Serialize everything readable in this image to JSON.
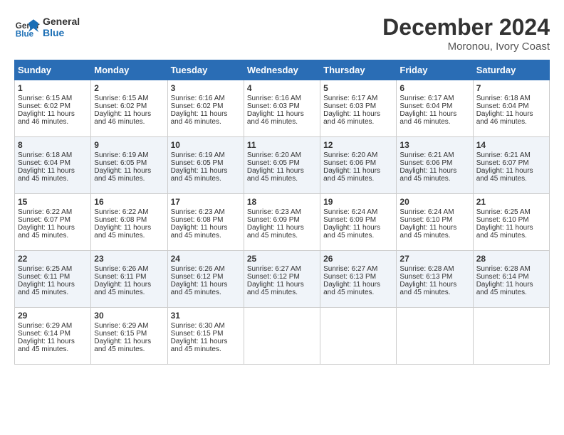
{
  "header": {
    "logo_line1": "General",
    "logo_line2": "Blue",
    "month_title": "December 2024",
    "location": "Moronou, Ivory Coast"
  },
  "days_of_week": [
    "Sunday",
    "Monday",
    "Tuesday",
    "Wednesday",
    "Thursday",
    "Friday",
    "Saturday"
  ],
  "weeks": [
    [
      {
        "day": "1",
        "sunrise": "Sunrise: 6:15 AM",
        "sunset": "Sunset: 6:02 PM",
        "daylight": "Daylight: 11 hours and 46 minutes."
      },
      {
        "day": "2",
        "sunrise": "Sunrise: 6:15 AM",
        "sunset": "Sunset: 6:02 PM",
        "daylight": "Daylight: 11 hours and 46 minutes."
      },
      {
        "day": "3",
        "sunrise": "Sunrise: 6:16 AM",
        "sunset": "Sunset: 6:02 PM",
        "daylight": "Daylight: 11 hours and 46 minutes."
      },
      {
        "day": "4",
        "sunrise": "Sunrise: 6:16 AM",
        "sunset": "Sunset: 6:03 PM",
        "daylight": "Daylight: 11 hours and 46 minutes."
      },
      {
        "day": "5",
        "sunrise": "Sunrise: 6:17 AM",
        "sunset": "Sunset: 6:03 PM",
        "daylight": "Daylight: 11 hours and 46 minutes."
      },
      {
        "day": "6",
        "sunrise": "Sunrise: 6:17 AM",
        "sunset": "Sunset: 6:04 PM",
        "daylight": "Daylight: 11 hours and 46 minutes."
      },
      {
        "day": "7",
        "sunrise": "Sunrise: 6:18 AM",
        "sunset": "Sunset: 6:04 PM",
        "daylight": "Daylight: 11 hours and 46 minutes."
      }
    ],
    [
      {
        "day": "8",
        "sunrise": "Sunrise: 6:18 AM",
        "sunset": "Sunset: 6:04 PM",
        "daylight": "Daylight: 11 hours and 45 minutes."
      },
      {
        "day": "9",
        "sunrise": "Sunrise: 6:19 AM",
        "sunset": "Sunset: 6:05 PM",
        "daylight": "Daylight: 11 hours and 45 minutes."
      },
      {
        "day": "10",
        "sunrise": "Sunrise: 6:19 AM",
        "sunset": "Sunset: 6:05 PM",
        "daylight": "Daylight: 11 hours and 45 minutes."
      },
      {
        "day": "11",
        "sunrise": "Sunrise: 6:20 AM",
        "sunset": "Sunset: 6:05 PM",
        "daylight": "Daylight: 11 hours and 45 minutes."
      },
      {
        "day": "12",
        "sunrise": "Sunrise: 6:20 AM",
        "sunset": "Sunset: 6:06 PM",
        "daylight": "Daylight: 11 hours and 45 minutes."
      },
      {
        "day": "13",
        "sunrise": "Sunrise: 6:21 AM",
        "sunset": "Sunset: 6:06 PM",
        "daylight": "Daylight: 11 hours and 45 minutes."
      },
      {
        "day": "14",
        "sunrise": "Sunrise: 6:21 AM",
        "sunset": "Sunset: 6:07 PM",
        "daylight": "Daylight: 11 hours and 45 minutes."
      }
    ],
    [
      {
        "day": "15",
        "sunrise": "Sunrise: 6:22 AM",
        "sunset": "Sunset: 6:07 PM",
        "daylight": "Daylight: 11 hours and 45 minutes."
      },
      {
        "day": "16",
        "sunrise": "Sunrise: 6:22 AM",
        "sunset": "Sunset: 6:08 PM",
        "daylight": "Daylight: 11 hours and 45 minutes."
      },
      {
        "day": "17",
        "sunrise": "Sunrise: 6:23 AM",
        "sunset": "Sunset: 6:08 PM",
        "daylight": "Daylight: 11 hours and 45 minutes."
      },
      {
        "day": "18",
        "sunrise": "Sunrise: 6:23 AM",
        "sunset": "Sunset: 6:09 PM",
        "daylight": "Daylight: 11 hours and 45 minutes."
      },
      {
        "day": "19",
        "sunrise": "Sunrise: 6:24 AM",
        "sunset": "Sunset: 6:09 PM",
        "daylight": "Daylight: 11 hours and 45 minutes."
      },
      {
        "day": "20",
        "sunrise": "Sunrise: 6:24 AM",
        "sunset": "Sunset: 6:10 PM",
        "daylight": "Daylight: 11 hours and 45 minutes."
      },
      {
        "day": "21",
        "sunrise": "Sunrise: 6:25 AM",
        "sunset": "Sunset: 6:10 PM",
        "daylight": "Daylight: 11 hours and 45 minutes."
      }
    ],
    [
      {
        "day": "22",
        "sunrise": "Sunrise: 6:25 AM",
        "sunset": "Sunset: 6:11 PM",
        "daylight": "Daylight: 11 hours and 45 minutes."
      },
      {
        "day": "23",
        "sunrise": "Sunrise: 6:26 AM",
        "sunset": "Sunset: 6:11 PM",
        "daylight": "Daylight: 11 hours and 45 minutes."
      },
      {
        "day": "24",
        "sunrise": "Sunrise: 6:26 AM",
        "sunset": "Sunset: 6:12 PM",
        "daylight": "Daylight: 11 hours and 45 minutes."
      },
      {
        "day": "25",
        "sunrise": "Sunrise: 6:27 AM",
        "sunset": "Sunset: 6:12 PM",
        "daylight": "Daylight: 11 hours and 45 minutes."
      },
      {
        "day": "26",
        "sunrise": "Sunrise: 6:27 AM",
        "sunset": "Sunset: 6:13 PM",
        "daylight": "Daylight: 11 hours and 45 minutes."
      },
      {
        "day": "27",
        "sunrise": "Sunrise: 6:28 AM",
        "sunset": "Sunset: 6:13 PM",
        "daylight": "Daylight: 11 hours and 45 minutes."
      },
      {
        "day": "28",
        "sunrise": "Sunrise: 6:28 AM",
        "sunset": "Sunset: 6:14 PM",
        "daylight": "Daylight: 11 hours and 45 minutes."
      }
    ],
    [
      {
        "day": "29",
        "sunrise": "Sunrise: 6:29 AM",
        "sunset": "Sunset: 6:14 PM",
        "daylight": "Daylight: 11 hours and 45 minutes."
      },
      {
        "day": "30",
        "sunrise": "Sunrise: 6:29 AM",
        "sunset": "Sunset: 6:15 PM",
        "daylight": "Daylight: 11 hours and 45 minutes."
      },
      {
        "day": "31",
        "sunrise": "Sunrise: 6:30 AM",
        "sunset": "Sunset: 6:15 PM",
        "daylight": "Daylight: 11 hours and 45 minutes."
      },
      null,
      null,
      null,
      null
    ]
  ]
}
